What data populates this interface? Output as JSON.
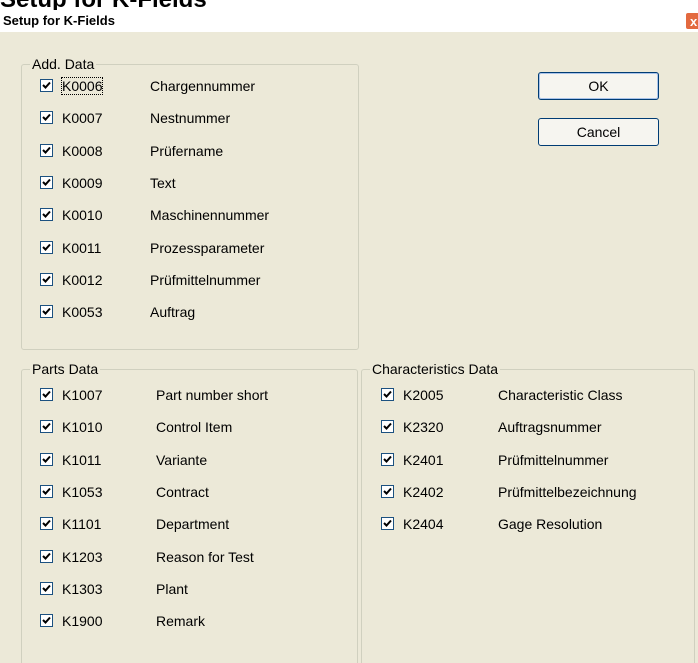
{
  "background_title": "Setup for K-Fields",
  "dialog": {
    "title": "Setup for K-Fields",
    "close_label": "x",
    "ok_label": "OK",
    "cancel_label": "Cancel"
  },
  "add_data": {
    "legend": "Add. Data",
    "items": [
      {
        "code": "K0006",
        "label": "Chargennummer",
        "checked": true
      },
      {
        "code": "K0007",
        "label": "Nestnummer",
        "checked": true
      },
      {
        "code": "K0008",
        "label": "Prüfername",
        "checked": true
      },
      {
        "code": "K0009",
        "label": "Text",
        "checked": true
      },
      {
        "code": "K0010",
        "label": "Maschinennummer",
        "checked": true
      },
      {
        "code": "K0011",
        "label": "Prozessparameter",
        "checked": true
      },
      {
        "code": "K0012",
        "label": "Prüfmittelnummer",
        "checked": true
      },
      {
        "code": "K0053",
        "label": "Auftrag",
        "checked": true
      }
    ]
  },
  "parts_data": {
    "legend": "Parts Data",
    "items": [
      {
        "code": "K1007",
        "label": "Part number short",
        "checked": true
      },
      {
        "code": "K1010",
        "label": "Control Item",
        "checked": true
      },
      {
        "code": "K1011",
        "label": "Variante",
        "checked": true
      },
      {
        "code": "K1053",
        "label": "Contract",
        "checked": true
      },
      {
        "code": "K1101",
        "label": "Department",
        "checked": true
      },
      {
        "code": "K1203",
        "label": "Reason for Test",
        "checked": true
      },
      {
        "code": "K1303",
        "label": "Plant",
        "checked": true
      },
      {
        "code": "K1900",
        "label": "Remark",
        "checked": true
      }
    ]
  },
  "characteristics_data": {
    "legend": "Characteristics Data",
    "items": [
      {
        "code": "K2005",
        "label": "Characteristic Class",
        "checked": true
      },
      {
        "code": "K2320",
        "label": "Auftragsnummer",
        "checked": true
      },
      {
        "code": "K2401",
        "label": "Prüfmittelnummer",
        "checked": true
      },
      {
        "code": "K2402",
        "label": "Prüfmittelbezeichnung",
        "checked": true
      },
      {
        "code": "K2404",
        "label": "Gage Resolution",
        "checked": true
      }
    ]
  },
  "colors": {
    "dialog_bg": "#ece9d8",
    "close_button": "#e3693f",
    "checkbox_border": "#1c5180",
    "checkmark": "#21a121"
  }
}
